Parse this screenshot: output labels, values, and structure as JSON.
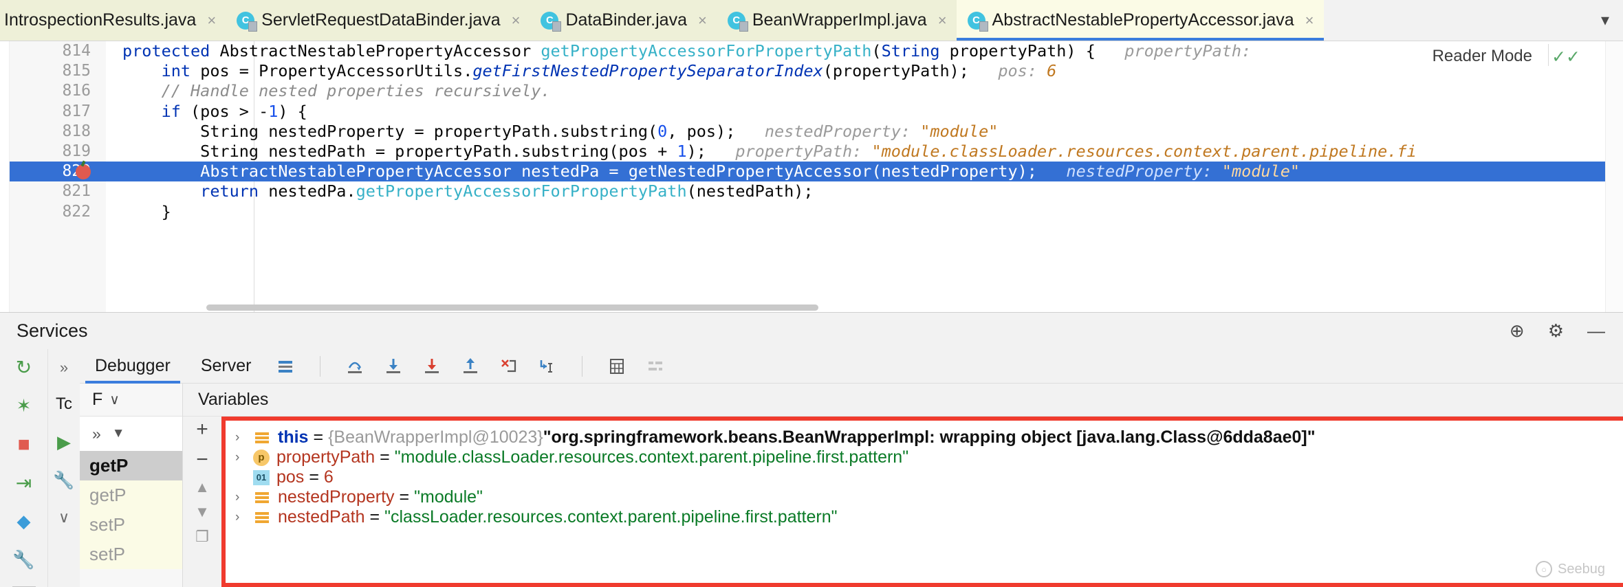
{
  "tabs": [
    {
      "label": "IntrospectionResults.java",
      "icon": "java-class-icon",
      "active": false,
      "truncated": true
    },
    {
      "label": "ServletRequestDataBinder.java",
      "icon": "java-class-icon",
      "active": false
    },
    {
      "label": "DataBinder.java",
      "icon": "java-class-icon",
      "active": false
    },
    {
      "label": "BeanWrapperImpl.java",
      "icon": "java-class-icon",
      "active": false
    },
    {
      "label": "AbstractNestablePropertyAccessor.java",
      "icon": "java-class-icon",
      "active": true
    }
  ],
  "tab_overflow_icon": "chevron-down-icon",
  "editor": {
    "reader_mode_label": "Reader Mode",
    "inspection_icon": "inspections-ok-icon",
    "lines": [
      {
        "number": "814",
        "fold": true,
        "breakpoint": false,
        "current": false,
        "indent": 0,
        "tokens": [
          {
            "t": "k",
            "v": "protected "
          },
          {
            "t": "txt",
            "v": "AbstractNestablePropertyAccessor "
          },
          {
            "t": "m",
            "v": "getPropertyAccessorForPropertyPath"
          },
          {
            "t": "txt",
            "v": "("
          },
          {
            "t": "k",
            "v": "String"
          },
          {
            "t": "txt",
            "v": " propertyPath) {"
          }
        ],
        "hint_label": "propertyPath:",
        "hint_value": ""
      },
      {
        "number": "815",
        "fold": false,
        "breakpoint": false,
        "current": false,
        "indent": 1,
        "tokens": [
          {
            "t": "k",
            "v": "    int"
          },
          {
            "t": "txt",
            "v": " pos = PropertyAccessorUtils."
          },
          {
            "t": "f",
            "v": "getFirstNestedPropertySeparatorIndex"
          },
          {
            "t": "txt",
            "v": "(propertyPath);"
          }
        ],
        "hint_label": "pos:",
        "hint_value": "6"
      },
      {
        "number": "816",
        "fold": false,
        "breakpoint": false,
        "current": false,
        "indent": 1,
        "tokens": [
          {
            "t": "cm",
            "v": "    // Handle nested properties recursively."
          }
        ],
        "hint_label": "",
        "hint_value": ""
      },
      {
        "number": "817",
        "fold": true,
        "breakpoint": false,
        "current": false,
        "indent": 1,
        "tokens": [
          {
            "t": "k",
            "v": "    if"
          },
          {
            "t": "txt",
            "v": " (pos > -"
          },
          {
            "t": "n",
            "v": "1"
          },
          {
            "t": "txt",
            "v": ") {"
          }
        ],
        "hint_label": "",
        "hint_value": ""
      },
      {
        "number": "818",
        "fold": false,
        "breakpoint": false,
        "current": false,
        "indent": 2,
        "tokens": [
          {
            "t": "txt",
            "v": "        String nestedProperty = propertyPath.substring("
          },
          {
            "t": "n",
            "v": "0"
          },
          {
            "t": "txt",
            "v": ", pos);"
          }
        ],
        "hint_label": "nestedProperty:",
        "hint_value": "\"module\""
      },
      {
        "number": "819",
        "fold": false,
        "breakpoint": false,
        "current": false,
        "indent": 2,
        "tokens": [
          {
            "t": "txt",
            "v": "        String nestedPath = propertyPath.substring(pos + "
          },
          {
            "t": "n",
            "v": "1"
          },
          {
            "t": "txt",
            "v": ");"
          }
        ],
        "hint_label": "propertyPath:",
        "hint_value": "\"module.classLoader.resources.context.parent.pipeline.fi"
      },
      {
        "number": "820",
        "fold": false,
        "breakpoint": true,
        "current": true,
        "indent": 2,
        "tokens": [
          {
            "t": "txt",
            "v": "        AbstractNestablePropertyAccessor nestedPa = "
          },
          {
            "t": "m",
            "v": "getNestedPropertyAccessor"
          },
          {
            "t": "txt",
            "v": "(nestedProperty);"
          }
        ],
        "hint_label": "nestedProperty:",
        "hint_value": "\"module\""
      },
      {
        "number": "821",
        "fold": false,
        "breakpoint": false,
        "current": false,
        "indent": 2,
        "tokens": [
          {
            "t": "k",
            "v": "        return"
          },
          {
            "t": "txt",
            "v": " nestedPa."
          },
          {
            "t": "m",
            "v": "getPropertyAccessorForPropertyPath"
          },
          {
            "t": "txt",
            "v": "(nestedPath);"
          }
        ],
        "hint_label": "",
        "hint_value": ""
      },
      {
        "number": "822",
        "fold": true,
        "breakpoint": false,
        "current": false,
        "indent": 1,
        "tokens": [
          {
            "t": "txt",
            "v": "    }"
          }
        ],
        "hint_label": "",
        "hint_value": ""
      }
    ]
  },
  "services": {
    "title": "Services",
    "actions": [
      {
        "name": "add-service-icon",
        "glyph": "⊕"
      },
      {
        "name": "settings-gear-icon",
        "glyph": "⚙"
      },
      {
        "name": "minimize-icon",
        "glyph": "—"
      }
    ]
  },
  "run_rail": [
    {
      "name": "rerun-icon",
      "glyph": "↻",
      "color": "#4a9c4a"
    },
    {
      "name": "rerun-debug-icon",
      "glyph": "✶",
      "color": "#4a9c4a"
    },
    {
      "name": "stop-icon",
      "glyph": "■",
      "color": "#e05a4f"
    },
    {
      "name": "resume-program-icon",
      "glyph": "⇥",
      "color": "#4a9c4a"
    },
    {
      "name": "mute-breakpoints-icon",
      "glyph": "◆",
      "color": "#3b9cd9"
    },
    {
      "name": "settings-wrench-icon",
      "glyph": "ὒ7",
      "color": "#4a4a4a"
    }
  ],
  "debugger": {
    "tabs": [
      {
        "label": "Debugger",
        "active": true
      },
      {
        "label": "Server",
        "active": false
      }
    ],
    "toolbar": [
      {
        "name": "layout-icon",
        "glyph": "≡"
      },
      {
        "name": "step-over-icon",
        "glyph": "⤴"
      },
      {
        "name": "step-into-icon",
        "glyph": "↓"
      },
      {
        "name": "force-step-into-icon",
        "glyph": "↓"
      },
      {
        "name": "step-out-icon",
        "glyph": "↑"
      },
      {
        "name": "drop-frame-icon",
        "glyph": "✗"
      },
      {
        "name": "run-to-cursor-icon",
        "glyph": "↘"
      },
      {
        "name": "evaluate-expression-icon",
        "glyph": "▦"
      },
      {
        "name": "settings-icon",
        "glyph": "⸺"
      }
    ],
    "frames": {
      "header_label": "F",
      "header_chevron": "chevron-down-icon",
      "thread_selector_overflow": "»",
      "thread_selector_chevron": "▼",
      "rows": [
        {
          "label": "getP",
          "state": "selected"
        },
        {
          "label": "getP",
          "state": "highlight"
        },
        {
          "label": "setP",
          "state": "highlight"
        },
        {
          "label": "setP",
          "state": "highlight"
        }
      ]
    },
    "side_tabs": {
      "overflow": "»",
      "threads_label": "Tc",
      "icons": [
        {
          "name": "resume-icon",
          "glyph": "▶"
        },
        {
          "name": "wrench-icon",
          "glyph": "ὒ7"
        },
        {
          "name": "chevron-down-icon",
          "glyph": "∨"
        }
      ]
    },
    "variables": {
      "header_label": "Variables",
      "buttons": [
        {
          "name": "add-watch-button",
          "glyph": "+"
        },
        {
          "name": "remove-watch-button",
          "glyph": "−"
        },
        {
          "name": "move-up-button",
          "glyph": "▲"
        },
        {
          "name": "move-down-button",
          "glyph": "▼"
        },
        {
          "name": "copy-button",
          "glyph": "❐"
        }
      ],
      "highlight_color": "#f03b2e",
      "rows": [
        {
          "expandable": true,
          "icon": "string-value-icon",
          "icon_kind": "str",
          "name": "this",
          "name_style": "this",
          "ref": "{BeanWrapperImpl@10023}",
          "value": "\"org.springframework.beans.BeanWrapperImpl: wrapping object [java.lang.Class@6dda8ae0]\"",
          "value_kind": "string"
        },
        {
          "expandable": true,
          "icon": "parameter-icon",
          "icon_kind": "p",
          "name": "propertyPath",
          "name_style": "normal",
          "ref": "",
          "value": "\"module.classLoader.resources.context.parent.pipeline.first.pattern\"",
          "value_kind": "string"
        },
        {
          "expandable": false,
          "icon": "primitive-value-icon",
          "icon_kind": "01",
          "name": "pos",
          "name_style": "normal",
          "ref": "",
          "value": "6",
          "value_kind": "number"
        },
        {
          "expandable": true,
          "icon": "string-value-icon",
          "icon_kind": "str",
          "name": "nestedProperty",
          "name_style": "normal",
          "ref": "",
          "value": "\"module\"",
          "value_kind": "string"
        },
        {
          "expandable": true,
          "icon": "string-value-icon",
          "icon_kind": "str",
          "name": "nestedPath",
          "name_style": "normal",
          "ref": "",
          "value": "\"classLoader.resources.context.parent.pipeline.first.pattern\"",
          "value_kind": "string"
        }
      ]
    }
  },
  "watermark": {
    "label": "Seebug",
    "icon": "seebug-logo-icon"
  }
}
